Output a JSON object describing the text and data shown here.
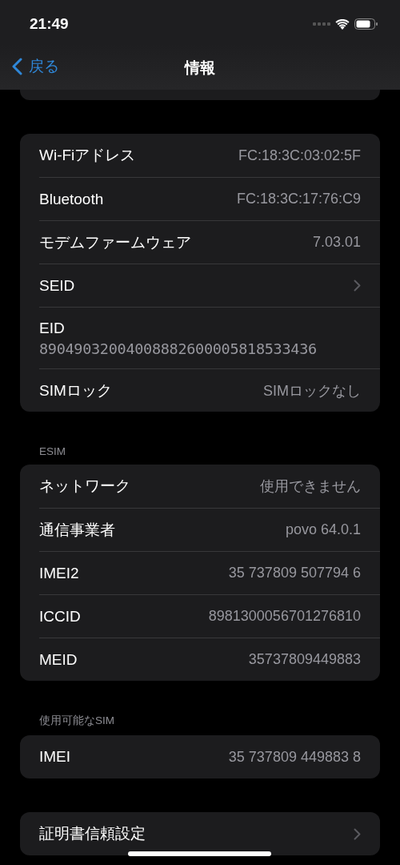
{
  "status_bar": {
    "time": "21:49"
  },
  "nav_bar": {
    "back": "戻る",
    "title": "情報"
  },
  "sections": [
    {
      "rows": [
        {
          "kind": "value",
          "label": "Wi-Fiアドレス",
          "value": "FC:18:3C:03:02:5F"
        },
        {
          "kind": "value",
          "label": "Bluetooth",
          "value": "FC:18:3C:17:76:C9"
        },
        {
          "kind": "value",
          "label": "モデムファームウェア",
          "value": "7.03.01"
        },
        {
          "kind": "link",
          "label": "SEID"
        },
        {
          "kind": "stacked",
          "label": "EID",
          "value": "89049032004008882600005818533436"
        },
        {
          "kind": "value",
          "label": "SIMロック",
          "value": "SIMロックなし"
        }
      ]
    },
    {
      "header": "ESIM",
      "rows": [
        {
          "kind": "value",
          "label": "ネットワーク",
          "value": "使用できません"
        },
        {
          "kind": "value",
          "label": "通信事業者",
          "value": "povo 64.0.1"
        },
        {
          "kind": "value",
          "label": "IMEI2",
          "value": "35 737809 507794 6"
        },
        {
          "kind": "value",
          "label": "ICCID",
          "value": "8981300056701276810"
        },
        {
          "kind": "value",
          "label": "MEID",
          "value": "35737809449883"
        }
      ]
    },
    {
      "header": "使用可能なSIM",
      "rows": [
        {
          "kind": "value",
          "label": "IMEI",
          "value": "35 737809 449883 8"
        }
      ]
    },
    {
      "rows": [
        {
          "kind": "link",
          "label": "証明書信頼設定"
        }
      ]
    }
  ]
}
